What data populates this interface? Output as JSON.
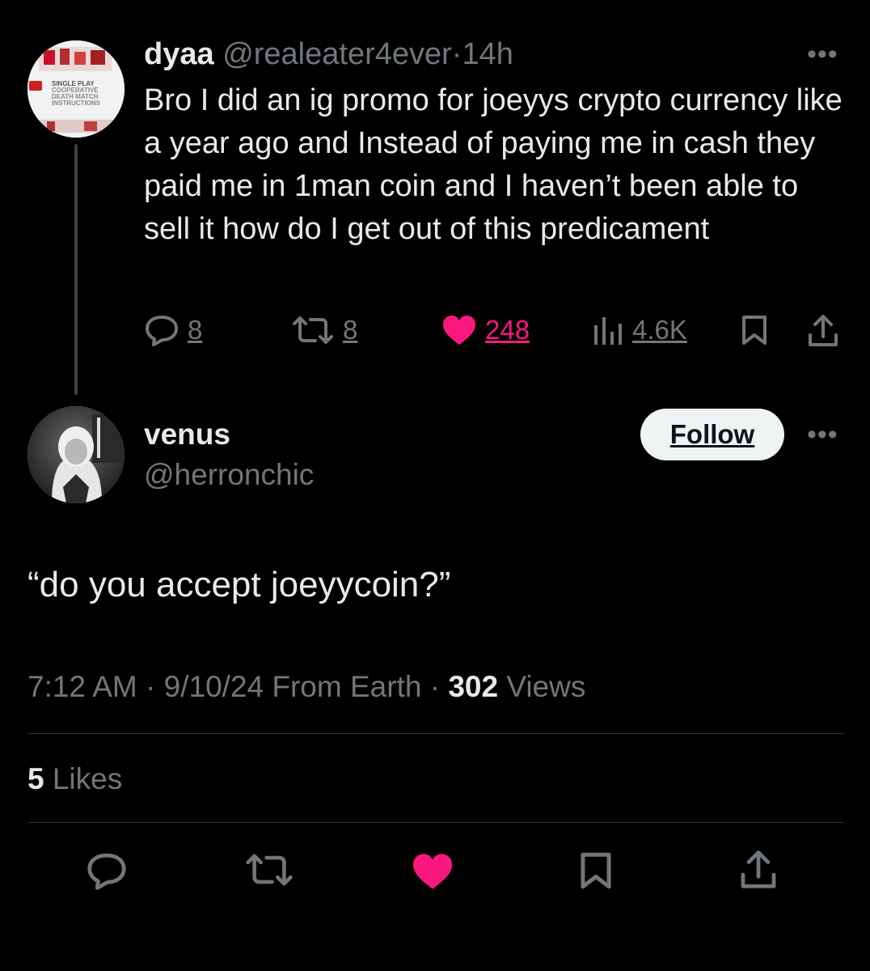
{
  "parent": {
    "avatar_lines": [
      "SINGLE PLAY",
      "COOPERATIVE",
      "DEATH MATCH",
      "INSTRUCTIONS"
    ],
    "name": "dyaa",
    "handle": "@realeater4ever",
    "separator": "·",
    "time": "14h",
    "text": "Bro I did an ig promo for joeyys crypto currency  like a year ago and Instead of paying me in cash they paid me in 1man coin and I haven’t been able to sell it  how do I get out of this predicament",
    "stats": {
      "replies": "8",
      "reposts": "8",
      "likes": "248",
      "views": "4.6K"
    },
    "icons": [
      "reply-icon",
      "repost-icon",
      "heart-icon",
      "views-icon",
      "bookmark-icon",
      "share-icon"
    ]
  },
  "reply": {
    "name": "venus",
    "handle": "@herronchic",
    "follow_label": "Follow",
    "text": "“do you accept joeyycoin?”",
    "time": "7:12 AM",
    "date_location": "9/10/24 From Earth",
    "separator": "·",
    "views_count": "302",
    "views_label": "Views",
    "likes_count": "5",
    "likes_label": "Likes"
  },
  "colors": {
    "background": "#000000",
    "text": "#e7e9ea",
    "muted": "#71767b",
    "like_pink": "#f91880",
    "follow_bg": "#eff3f4"
  }
}
